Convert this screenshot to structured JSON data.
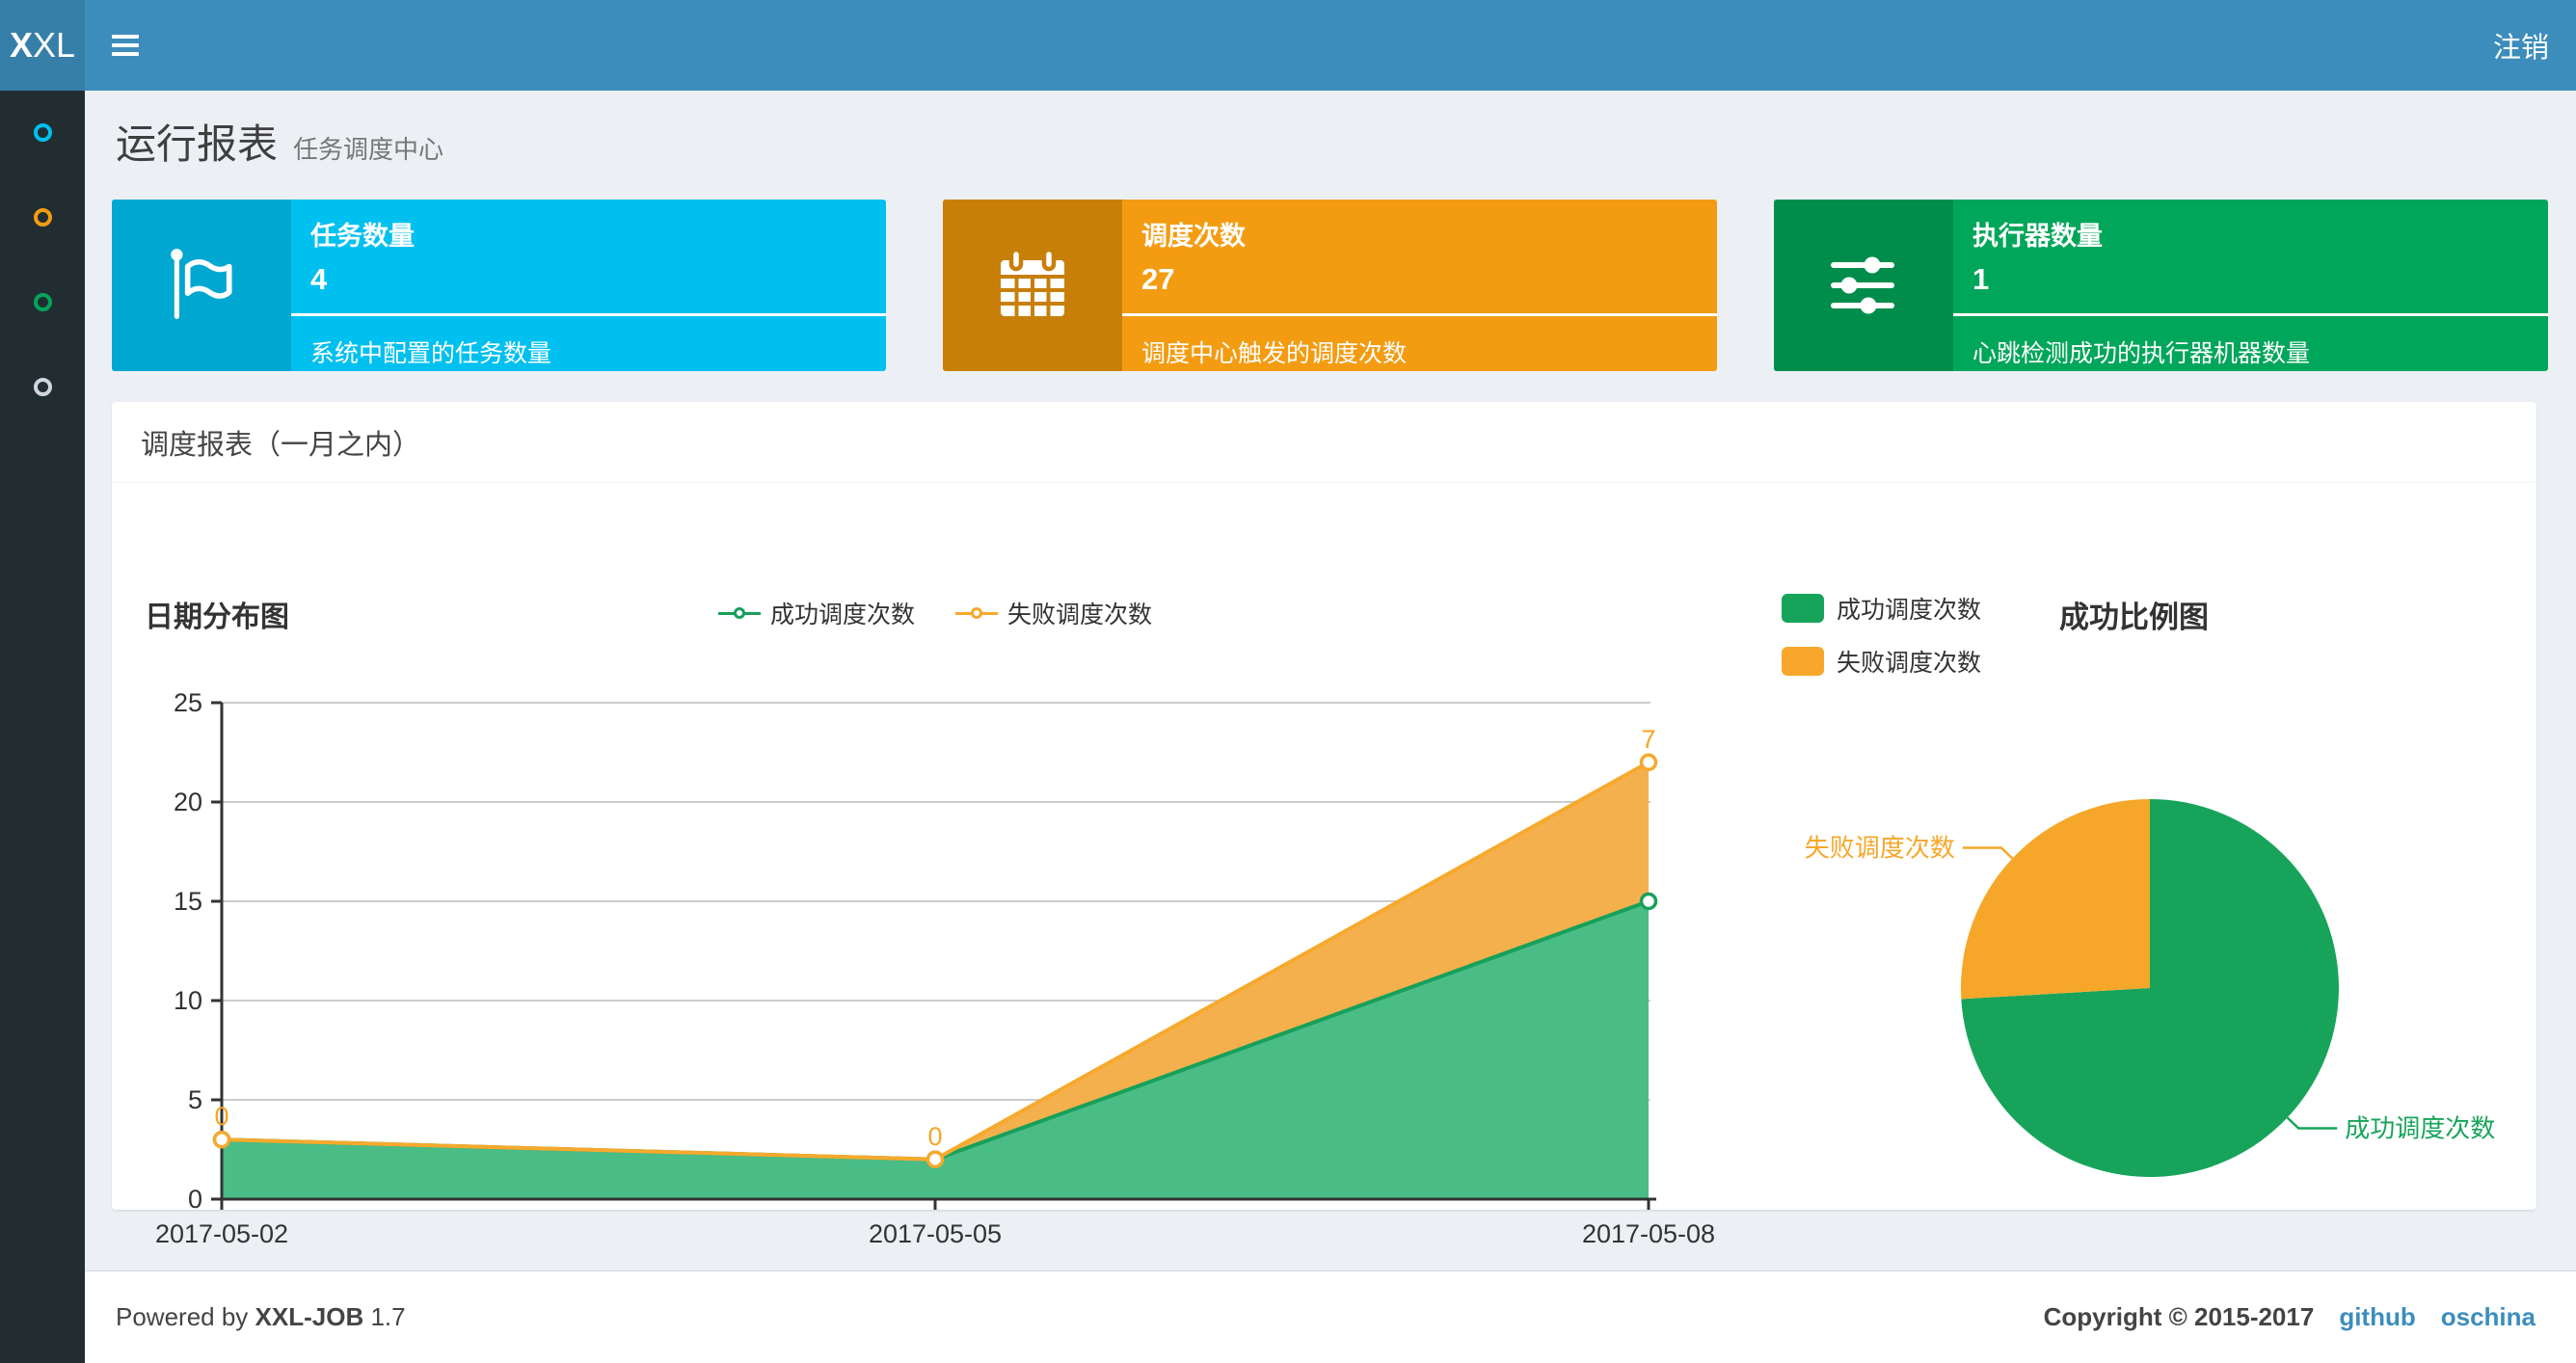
{
  "navbar": {
    "logo_bold": "X",
    "logo_rest": "XL",
    "logout": "注销",
    "hamburger_icon": "menu-icon"
  },
  "sidebar": {
    "items": [
      {
        "id": "1",
        "icon": "circle-icon",
        "color": "#00c0ef"
      },
      {
        "id": "2",
        "icon": "circle-icon",
        "color": "#f39c12"
      },
      {
        "id": "3",
        "icon": "circle-icon",
        "color": "#00a65a"
      },
      {
        "id": "4",
        "icon": "circle-icon",
        "color": "#d2d6de"
      }
    ]
  },
  "page": {
    "title": "运行报表",
    "subtitle": "任务调度中心"
  },
  "stat_cards": [
    {
      "id": "jobs",
      "title": "任务数量",
      "value": "4",
      "desc": "系统中配置的任务数量",
      "color": "#00c0ef",
      "icon_bg": "#00a7d0",
      "icon": "flag-icon"
    },
    {
      "id": "triggers",
      "title": "调度次数",
      "value": "27",
      "desc": "调度中心触发的调度次数",
      "color": "#f39c12",
      "icon_bg": "#c87f0a",
      "icon": "calendar-icon"
    },
    {
      "id": "executors",
      "title": "执行器数量",
      "value": "1",
      "desc": "心跳检测成功的执行器机器数量",
      "color": "#00a65a",
      "icon_bg": "#008d4c",
      "icon": "sliders-icon"
    }
  ],
  "panel": {
    "title": "调度报表（一月之内）"
  },
  "chart_data": [
    {
      "type": "area",
      "title": "日期分布图",
      "categories": [
        "2017-05-02",
        "2017-05-05",
        "2017-05-08"
      ],
      "stacked": true,
      "grid": true,
      "legend_position": "top",
      "ylim": [
        0,
        25
      ],
      "yticks": [
        0,
        5,
        10,
        15,
        20,
        25
      ],
      "series": [
        {
          "id": "success",
          "name": "成功调度次数",
          "values": [
            3,
            2,
            15
          ],
          "color": "#17a05a",
          "fill": "#4abc86",
          "show_point_labels": false
        },
        {
          "id": "fail",
          "name": "失败调度次数",
          "values": [
            0,
            0,
            7
          ],
          "color": "#f7a92d",
          "fill": "#f5b04e",
          "show_point_labels": true,
          "label_color": "#f5a623"
        }
      ]
    },
    {
      "type": "pie",
      "title": "成功比例图",
      "total": 27,
      "slices": [
        {
          "id": "success",
          "label": "成功调度次数",
          "value": 20,
          "color": "#17a45a"
        },
        {
          "id": "fail",
          "label": "失败调度次数",
          "value": 7,
          "color": "#f6a72a"
        }
      ]
    }
  ],
  "footer": {
    "powered_prefix": "Powered by",
    "brand": "XXL-JOB",
    "version": "1.7",
    "copyright": "Copyright © 2015-2017",
    "links": [
      "github",
      "oschina"
    ]
  },
  "theme": {
    "navbar": "#3c8dbc",
    "logo_bg": "#367fa9",
    "sidebar_bg": "#222d32",
    "page_bg": "#ecf0f5",
    "link": "#3c8dbc",
    "axis": "#333333",
    "grid": "#cccccc"
  }
}
